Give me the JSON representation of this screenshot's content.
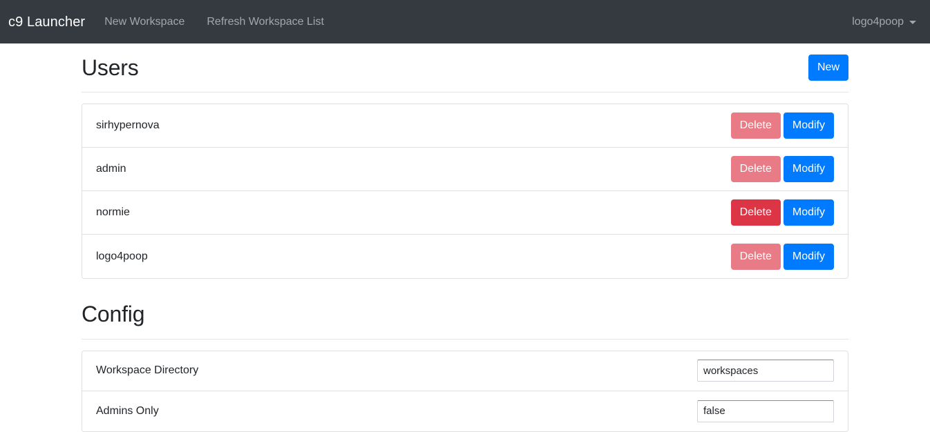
{
  "navbar": {
    "brand": "c9 Launcher",
    "links": [
      {
        "label": "New Workspace"
      },
      {
        "label": "Refresh Workspace List"
      }
    ],
    "user": {
      "label": "logo4poop",
      "caret_icon": "chevron-down-icon"
    },
    "background_color": "#343a40"
  },
  "users_section": {
    "title": "Users",
    "new_button": "New",
    "delete_label": "Delete",
    "modify_label": "Modify",
    "accent_color": "#007bff",
    "danger_color": "#dc3545",
    "rows": [
      {
        "username": "sirhypernova",
        "delete_enabled": false
      },
      {
        "username": "admin",
        "delete_enabled": false
      },
      {
        "username": "normie",
        "delete_enabled": true
      },
      {
        "username": "logo4poop",
        "delete_enabled": false
      }
    ]
  },
  "config_section": {
    "title": "Config",
    "rows": [
      {
        "label": "Workspace Directory",
        "value": "workspaces"
      },
      {
        "label": "Admins Only",
        "value": "false"
      }
    ]
  }
}
